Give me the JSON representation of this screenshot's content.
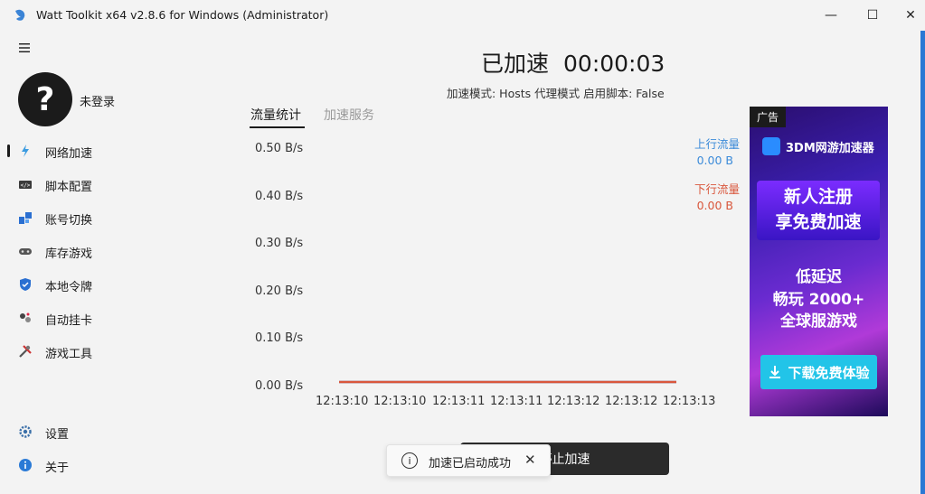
{
  "window": {
    "title": "Watt Toolkit x64 v2.8.6 for Windows (Administrator)",
    "minimize": "—",
    "maximize": "☐",
    "close": "✕"
  },
  "user": {
    "avatar_glyph": "?",
    "login_status": "未登录"
  },
  "sidebar": {
    "items": [
      {
        "label": "网络加速",
        "icon": "lightning-icon",
        "selected": true
      },
      {
        "label": "脚本配置",
        "icon": "script-icon",
        "selected": false
      },
      {
        "label": "账号切换",
        "icon": "account-switch-icon",
        "selected": false
      },
      {
        "label": "库存游戏",
        "icon": "gamepad-icon",
        "selected": false
      },
      {
        "label": "本地令牌",
        "icon": "shield-icon",
        "selected": false
      },
      {
        "label": "自动挂卡",
        "icon": "auto-card-icon",
        "selected": false
      },
      {
        "label": "游戏工具",
        "icon": "tools-icon",
        "selected": false
      }
    ],
    "bottom_items": [
      {
        "label": "设置",
        "icon": "gear-icon"
      },
      {
        "label": "关于",
        "icon": "info-icon"
      }
    ]
  },
  "accel": {
    "status": "已加速",
    "elapsed": "00:00:03",
    "mode_line": "加速模式: Hosts 代理模式   启用脚本: False"
  },
  "tabs": [
    {
      "label": "流量统计",
      "active": true
    },
    {
      "label": "加速服务",
      "active": false
    }
  ],
  "legend": {
    "up_label": "上行流量",
    "up_value": "0.00 B",
    "up_color": "#3c8bd9",
    "down_label": "下行流量",
    "down_value": "0.00 B",
    "down_color": "#d9573c"
  },
  "chart_data": {
    "type": "line",
    "x": [
      "12:13:10",
      "12:13:10",
      "12:13:11",
      "12:13:11",
      "12:13:12",
      "12:13:12",
      "12:13:13"
    ],
    "y_ticks": [
      "0.50 B/s",
      "0.40 B/s",
      "0.30 B/s",
      "0.20 B/s",
      "0.10 B/s",
      "0.00 B/s"
    ],
    "ylim": [
      0,
      0.5
    ],
    "series": [
      {
        "name": "上行流量",
        "values": [
          0,
          0,
          0,
          0,
          0,
          0,
          0
        ],
        "color": "#3c8bd9"
      },
      {
        "name": "下行流量",
        "values": [
          0,
          0,
          0,
          0,
          0,
          0,
          0
        ],
        "color": "#d9573c"
      }
    ]
  },
  "ad": {
    "tag": "广告",
    "brand": "3DM网游加速器",
    "banner_line1": "新人注册",
    "banner_line2": "享免费加速",
    "line1": "低延迟",
    "line2": "畅玩 2000+",
    "line3": "全球服游戏",
    "button": "下载免费体验"
  },
  "stop_button": "停止加速",
  "toast": {
    "message": "加速已启动成功",
    "close": "✕"
  }
}
